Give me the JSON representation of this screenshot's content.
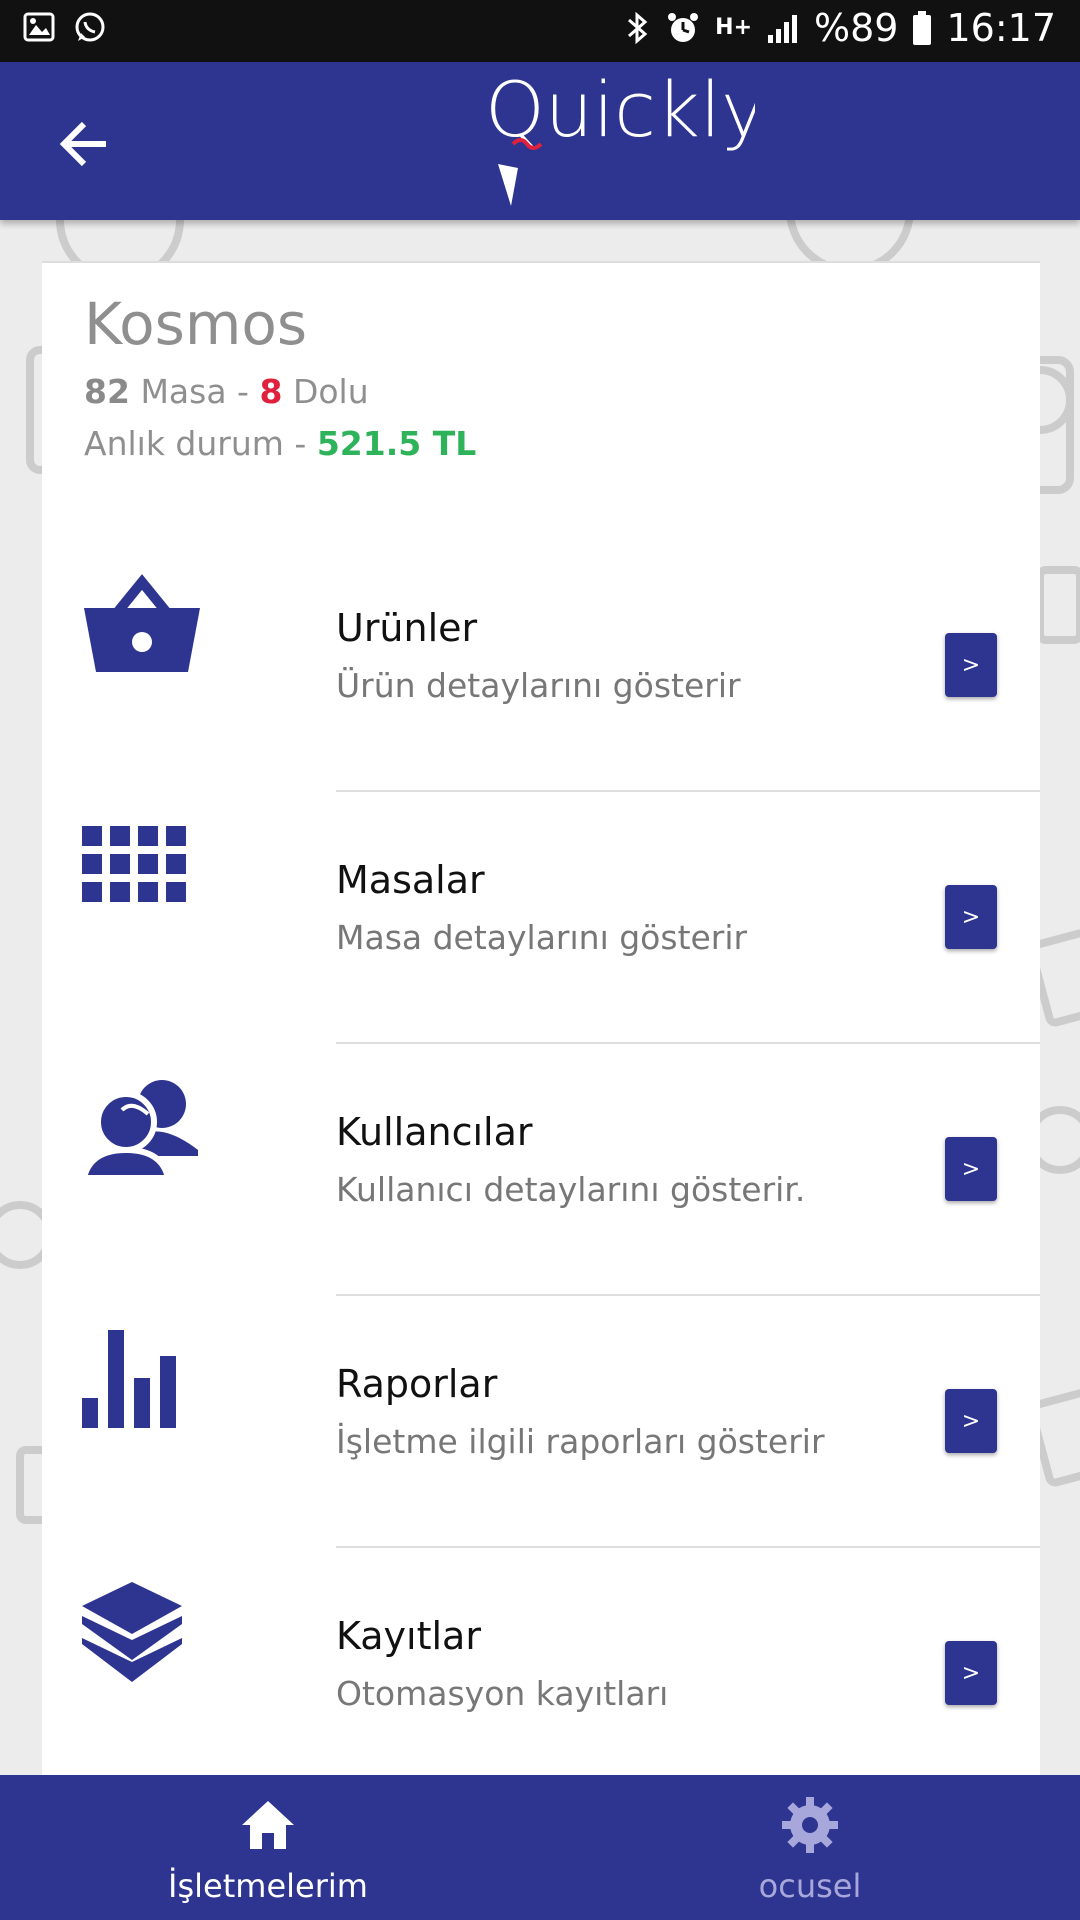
{
  "status_bar": {
    "battery": "%89",
    "time": "16:17",
    "network": "H+",
    "icons": [
      "image-icon",
      "whatsapp-icon",
      "bluetooth-icon",
      "alarm-icon",
      "signal-icon",
      "battery-icon"
    ]
  },
  "app_bar": {
    "logo_text": "Quickly",
    "back_icon": "arrow-left-icon"
  },
  "business": {
    "name": "Kosmos",
    "table_count": "82",
    "table_label": "Masa",
    "separator": "-",
    "occupied_count": "8",
    "occupied_label": "Dolu",
    "status_label": "Anlık durum -",
    "status_value": "521.5 TL"
  },
  "menu": [
    {
      "title": "Urünler",
      "subtitle": "Ürün detaylarını gösterir",
      "icon": "basket-icon",
      "button": ">"
    },
    {
      "title": "Masalar",
      "subtitle": "Masa detaylarını gösterir",
      "icon": "grid-icon",
      "button": ">"
    },
    {
      "title": "Kullancılar",
      "subtitle": "Kullanıcı detaylarını gösterir.",
      "icon": "users-icon",
      "button": ">"
    },
    {
      "title": "Raporlar",
      "subtitle": "İşletme ilgili raporları gösterir",
      "icon": "bar-chart-icon",
      "button": ">"
    },
    {
      "title": "Kayıtlar",
      "subtitle": "Otomasyon kayıtları",
      "icon": "layers-icon",
      "button": ">"
    }
  ],
  "bottom_nav": {
    "tabs": [
      {
        "label": "İşletmelerim",
        "icon": "home-icon",
        "active": true
      },
      {
        "label": "ocusel",
        "icon": "gear-icon",
        "active": false
      }
    ]
  },
  "colors": {
    "primary": "#2e3590",
    "occupied": "#e0213d",
    "revenue": "#2fb35a",
    "inactive_tab": "#a8a7dc"
  }
}
